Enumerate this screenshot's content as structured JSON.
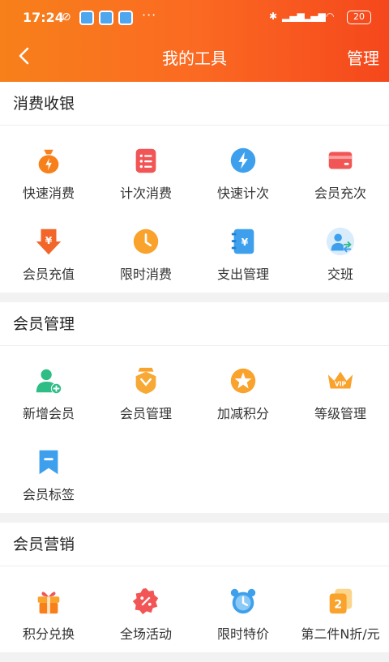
{
  "status_bar": {
    "time": "17:24",
    "battery": "20"
  },
  "navbar": {
    "title": "我的工具",
    "manage": "管理"
  },
  "sections": [
    {
      "title": "消费收银",
      "items": [
        {
          "label": "快速消费",
          "icon": "money-bag-icon"
        },
        {
          "label": "计次消费",
          "icon": "list-icon"
        },
        {
          "label": "快速计次",
          "icon": "lightning-icon"
        },
        {
          "label": "会员充次",
          "icon": "card-icon"
        },
        {
          "label": "会员充值",
          "icon": "yen-arrow-icon"
        },
        {
          "label": "限时消费",
          "icon": "clock-icon"
        },
        {
          "label": "支出管理",
          "icon": "ledger-icon"
        },
        {
          "label": "交班",
          "icon": "handover-icon"
        }
      ]
    },
    {
      "title": "会员管理",
      "items": [
        {
          "label": "新增会员",
          "icon": "add-user-icon"
        },
        {
          "label": "会员管理",
          "icon": "badge-icon"
        },
        {
          "label": "加减积分",
          "icon": "star-icon"
        },
        {
          "label": "等级管理",
          "icon": "vip-crown-icon"
        },
        {
          "label": "会员标签",
          "icon": "tag-icon"
        }
      ]
    },
    {
      "title": "会员营销",
      "items": [
        {
          "label": "积分兑换",
          "icon": "gift-icon"
        },
        {
          "label": "全场活动",
          "icon": "discount-icon"
        },
        {
          "label": "限时特价",
          "icon": "alarm-icon"
        },
        {
          "label": "第二件N折/元",
          "icon": "second-item-icon"
        }
      ]
    }
  ],
  "colors": {
    "orange": "#f7801a",
    "blue": "#3ea0ec",
    "green": "#2ebd85",
    "red": "#f25555"
  }
}
